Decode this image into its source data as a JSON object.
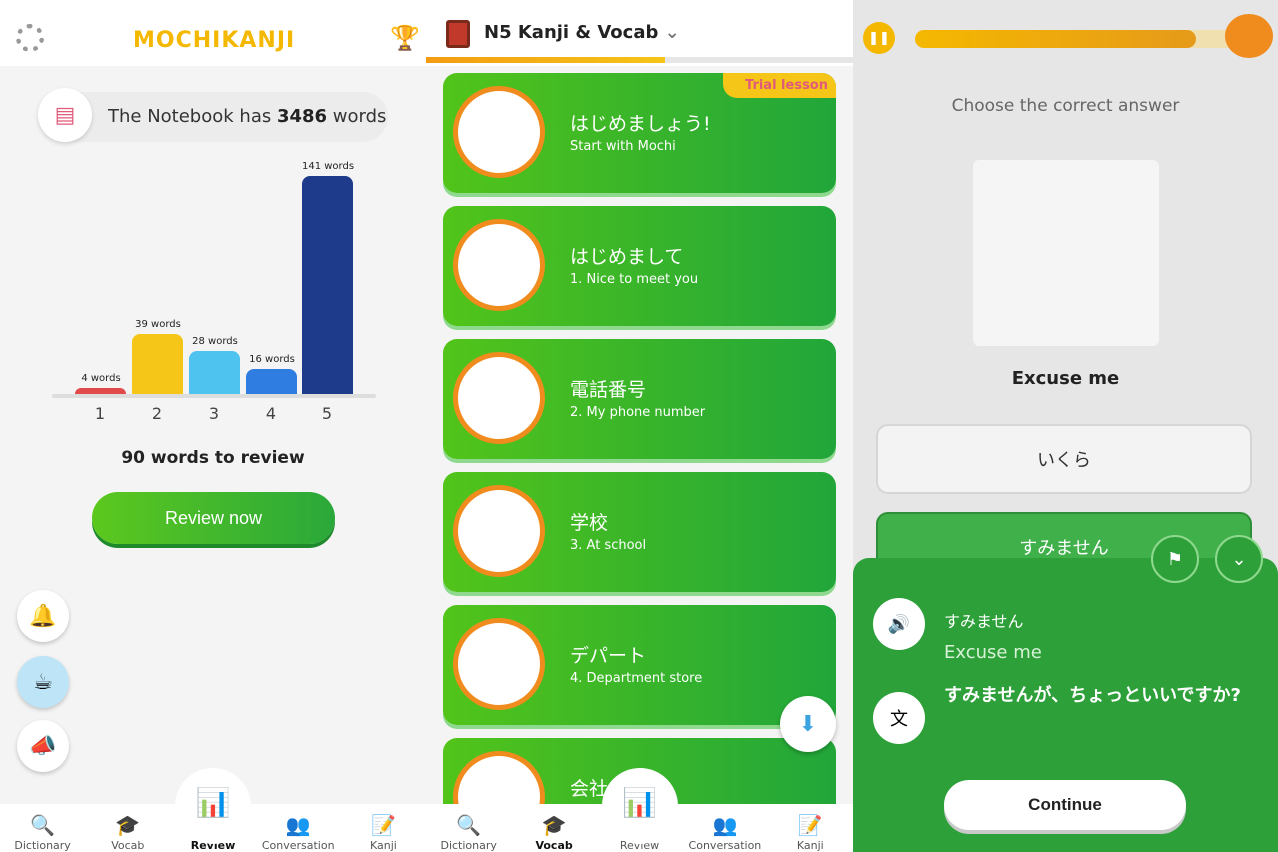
{
  "left": {
    "logo": "MOCHIKANJI",
    "notebook": {
      "prefix": "The Notebook has ",
      "count": "3486",
      "suffix": " words"
    },
    "chart_data": {
      "type": "bar",
      "categories": [
        "1",
        "2",
        "3",
        "4",
        "5"
      ],
      "values": [
        4,
        39,
        28,
        16,
        141
      ],
      "data_labels": [
        "4 words",
        "39 words",
        "28 words",
        "16 words",
        "141 words"
      ],
      "colors": [
        "#e04a4a",
        "#f5c518",
        "#4fc3f0",
        "#2f7de1",
        "#1e3a8a"
      ]
    },
    "to_review": "90 words to review",
    "review_button": "Review now"
  },
  "mid": {
    "header_title": "N5 Kanji & Vocab",
    "course_progress_percent": 56,
    "trial_label": "Trial lesson",
    "lessons": [
      {
        "jp": "はじめましょう!",
        "en": "Start with Mochi"
      },
      {
        "jp": "はじめまして",
        "en": "1. Nice to meet you"
      },
      {
        "jp": "電話番号",
        "en": "2. My phone number"
      },
      {
        "jp": "学校",
        "en": "3. At school"
      },
      {
        "jp": "デパート",
        "en": "4.  Department store"
      },
      {
        "jp": "会社",
        "en": ""
      }
    ]
  },
  "nav_left": [
    "Dictionary",
    "Vocab",
    "Review",
    "Conversation",
    "Kanji"
  ],
  "nav_mid": [
    "Dictionary",
    "Vocab",
    "Review",
    "Conversation",
    "Kanji"
  ],
  "right": {
    "quiz_progress_percent": 85,
    "question": "Choose the correct answer",
    "word": "Excuse me",
    "options": [
      "いくら",
      "すみません"
    ],
    "feedback": {
      "answer_jp": "すみません",
      "answer_en": "Excuse me",
      "example": "すみませんが、ちょっといいですか?",
      "continue": "Continue"
    }
  }
}
